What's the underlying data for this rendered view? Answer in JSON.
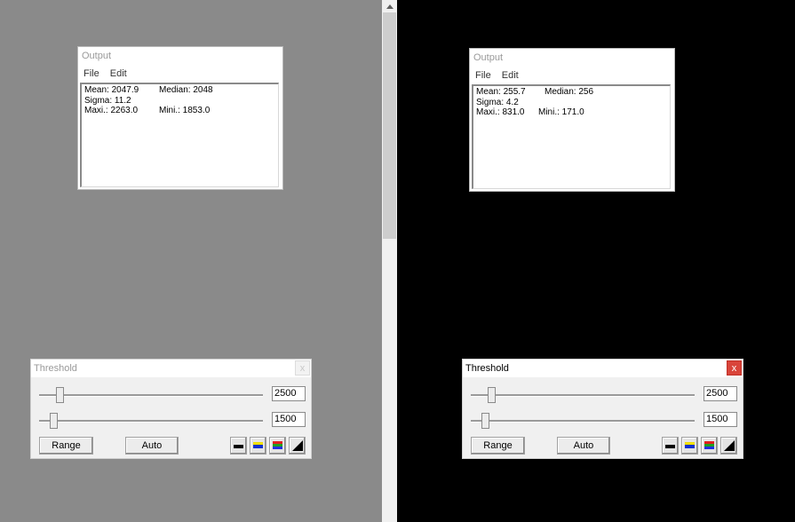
{
  "left": {
    "output": {
      "title": "Output",
      "menu": [
        "File",
        "Edit"
      ],
      "stats": {
        "mean": "Mean: 2047.9",
        "median": "Median: 2048",
        "sigma": "Sigma: 11.2",
        "maxi": "Maxi.: 2263.0",
        "mini": "Mini.: 1853.0"
      }
    },
    "threshold": {
      "title": "Threshold",
      "close": "x",
      "upper_value": "2500",
      "lower_value": "1500",
      "upper_level": 0.08,
      "lower_level": 0.05,
      "range_label": "Range",
      "auto_label": "Auto"
    }
  },
  "right": {
    "output": {
      "title": "Output",
      "menu": [
        "File",
        "Edit"
      ],
      "stats": {
        "mean": "Mean: 255.7",
        "median": "Median: 256",
        "sigma": "Sigma: 4.2",
        "maxi": "Maxi.: 831.0",
        "mini": "Mini.: 171.0"
      }
    },
    "threshold": {
      "title": "Threshold",
      "close": "x",
      "upper_value": "2500",
      "lower_value": "1500",
      "upper_level": 0.08,
      "lower_level": 0.05,
      "range_label": "Range",
      "auto_label": "Auto"
    }
  },
  "icons": {
    "threshold_buttons": [
      "black-white-lut-icon",
      "yellow-blue-lut-icon",
      "rgb-lut-icon",
      "ramp-lut-icon"
    ]
  },
  "colors": {
    "left_background": "#8a8a8a",
    "right_background": "#000000",
    "close_active": "#d9443a"
  }
}
